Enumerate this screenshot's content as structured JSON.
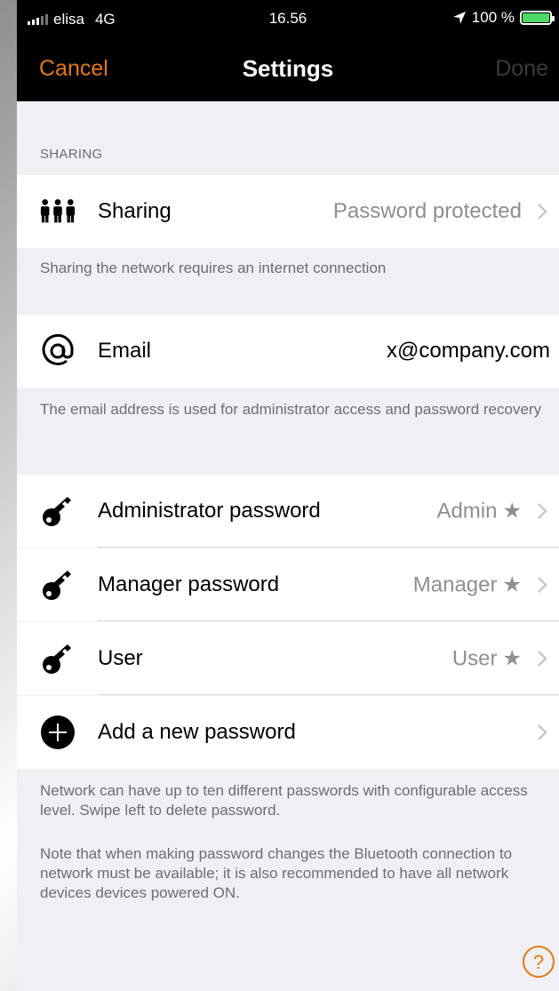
{
  "status_bar": {
    "carrier": "elisa",
    "network": "4G",
    "time": "16.56",
    "battery": "100 %"
  },
  "nav": {
    "cancel": "Cancel",
    "title": "Settings",
    "done": "Done"
  },
  "sections": {
    "sharing_header": "SHARING",
    "sharing_row": {
      "label": "Sharing",
      "value": "Password protected",
      "icon": "people-icon"
    },
    "sharing_footer": "Sharing the network requires an internet connection",
    "email_row": {
      "label": "Email",
      "value": "x@company.com",
      "icon": "at-sign-icon"
    },
    "email_footer": "The email address is used for administrator access and password recovery",
    "passwords": [
      {
        "label": "Administrator password",
        "value": "Admin",
        "icon": "key-icon"
      },
      {
        "label": "Manager password",
        "value": "Manager",
        "icon": "key-icon"
      },
      {
        "label": "User",
        "value": "User",
        "icon": "key-icon"
      }
    ],
    "add_password": {
      "label": "Add a new password",
      "icon": "plus-circle-icon"
    },
    "passwords_footer_1": "Network can have up to ten different passwords with configurable access level. Swipe left to delete password.",
    "passwords_footer_2": "Note that when making password changes the Bluetooth connection to network must be available; it is also recommended to have all network devices devices powered ON."
  },
  "colors": {
    "accent": "#e07a16",
    "background": "#efeff4",
    "secondary_text": "#8e8e93"
  }
}
